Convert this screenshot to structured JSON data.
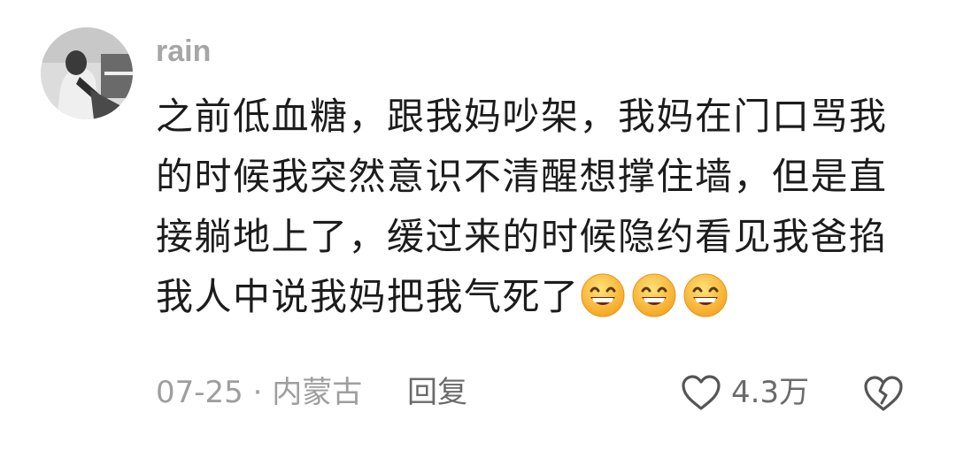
{
  "comment": {
    "username": "rain",
    "avatar_icon": "avatar-photo",
    "text_lines": [
      "之前低血糖，跟我妈吵架，我妈在门口骂我",
      "的时候我突然意识不清醒想撑住墙，但是直",
      "接躺地上了，缓过来的时候隐约看见我爸掐",
      "我人中说我妈把我气死了"
    ],
    "emoji": [
      "grinning-face",
      "grinning-face",
      "grinning-face"
    ],
    "date": "07-25",
    "separator": "·",
    "location": "内蒙古",
    "reply_label": "回复",
    "like_count": "4.3万",
    "like_icon": "heart-outline-icon",
    "dislike_icon": "broken-heart-icon"
  },
  "colors": {
    "text": "#1c1c1c",
    "secondary": "#9e9e9e",
    "action": "#6b6b6b"
  }
}
